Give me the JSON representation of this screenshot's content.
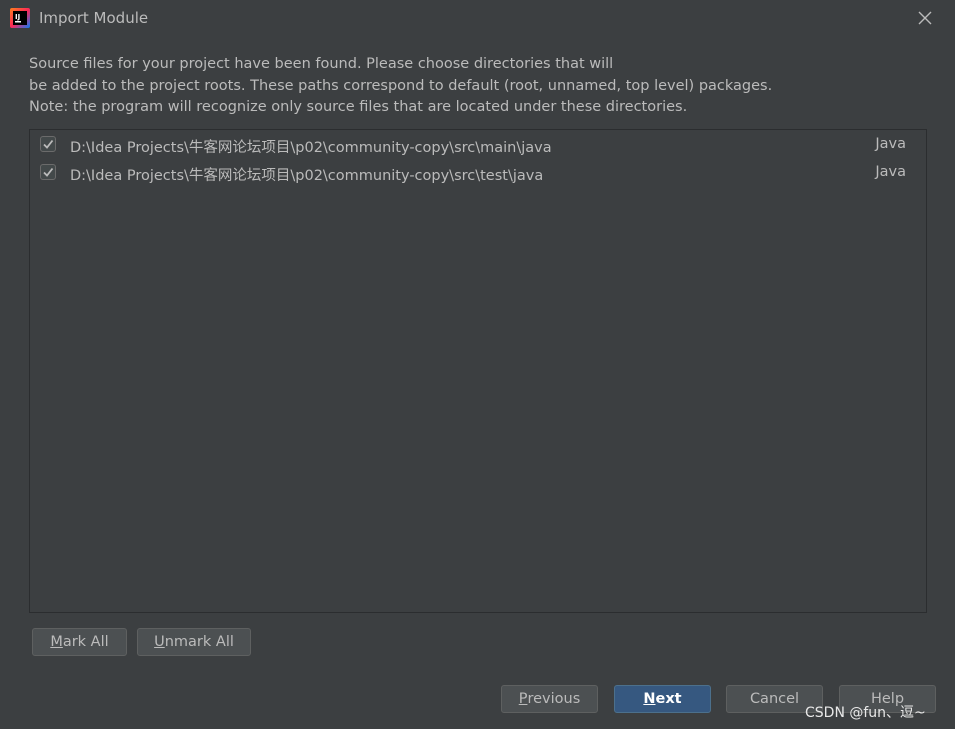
{
  "window": {
    "title": "Import Module",
    "icon": "intellij-app-icon",
    "close_icon": "close-icon"
  },
  "description": {
    "line1": "Source files for your project have been found. Please choose directories that will",
    "line2": "be added to the project roots. These paths correspond to default (root, unnamed, top level) packages.",
    "line3": "Note: the program will recognize only source files that are located under these directories."
  },
  "directories": [
    {
      "checked": true,
      "path": "D:\\Idea Projects\\牛客网论坛项目\\p02\\community-copy\\src\\main\\java",
      "type": "Java"
    },
    {
      "checked": true,
      "path": "D:\\Idea Projects\\牛客网论坛项目\\p02\\community-copy\\src\\test\\java",
      "type": "Java"
    }
  ],
  "buttons": {
    "mark_all_mnemonic": "M",
    "mark_all_rest": "ark All",
    "unmark_all_mnemonic": "U",
    "unmark_all_rest": "nmark All",
    "previous_mnemonic": "P",
    "previous_rest": "revious",
    "next_mnemonic": "N",
    "next_rest": "ext",
    "cancel": "Cancel",
    "help": "Help"
  },
  "watermark": "CSDN @fun、逗~",
  "colors": {
    "background": "#3c3f41",
    "primary_button": "#365880",
    "text": "#bbbbbb"
  }
}
